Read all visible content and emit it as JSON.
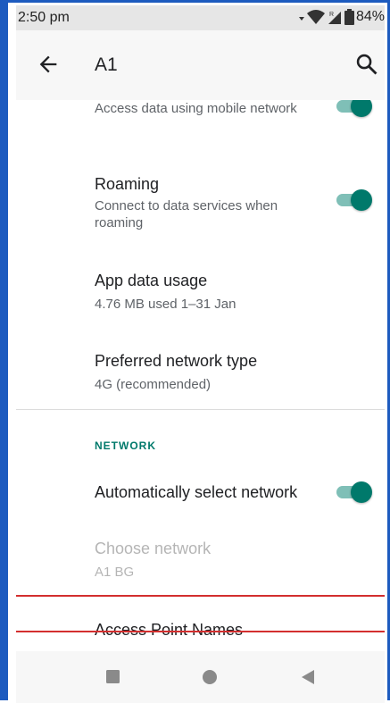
{
  "status_bar": {
    "time": "2:50 pm",
    "battery": "84%"
  },
  "app_bar": {
    "title": "A1"
  },
  "settings": [
    {
      "subtitle": "Access data using mobile network",
      "toggle_on": true
    },
    {
      "title": "Roaming",
      "subtitle": "Connect to data services when roaming",
      "toggle_on": true
    },
    {
      "title": "App data usage",
      "subtitle": "4.76 MB used 1–31 Jan"
    },
    {
      "title": "Preferred network type",
      "subtitle": "4G (recommended)"
    }
  ],
  "network_section": {
    "header": "NETWORK",
    "auto_select": {
      "title": "Automatically select network",
      "toggle_on": true
    },
    "choose_network": {
      "title": "Choose network",
      "subtitle": "A1 BG",
      "enabled": false
    },
    "apn": {
      "title": "Access Point Names"
    }
  },
  "colors": {
    "accent": "#00796b",
    "frame": "#1d5bbf",
    "highlight": "#d32f2f"
  }
}
